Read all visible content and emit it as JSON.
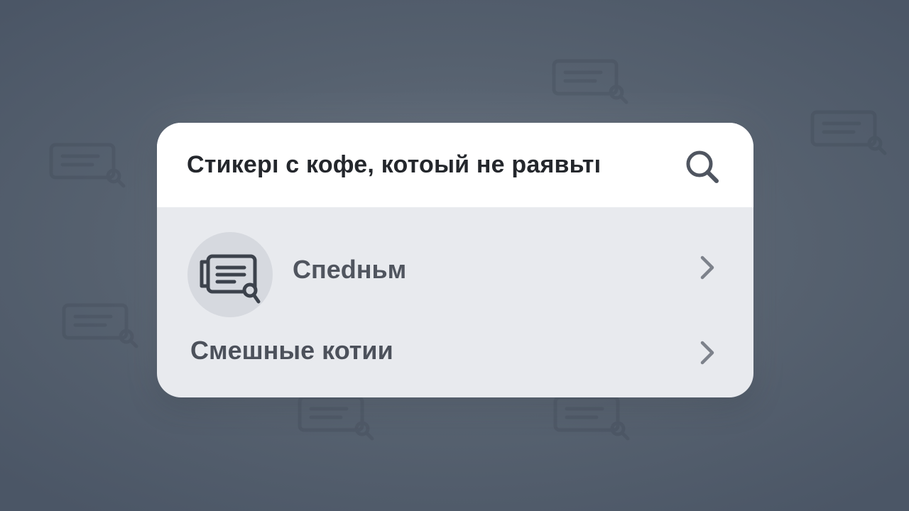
{
  "search": {
    "query": "Стикерı с кофе, котоый не раявьтı",
    "icon": "search-icon"
  },
  "results": [
    {
      "label": "Cпedньм",
      "icon": "sticker-icon",
      "chevron": "chevron-right-icon"
    },
    {
      "label": "Смешные котии",
      "chevron": "chevron-right-icon"
    }
  ],
  "colors": {
    "background": "#56616f",
    "card": "#e8eaee",
    "search_bar": "#ffffff",
    "text_primary": "#24272c",
    "text_secondary": "#4c515b",
    "avatar_bg": "#d6d9df"
  }
}
